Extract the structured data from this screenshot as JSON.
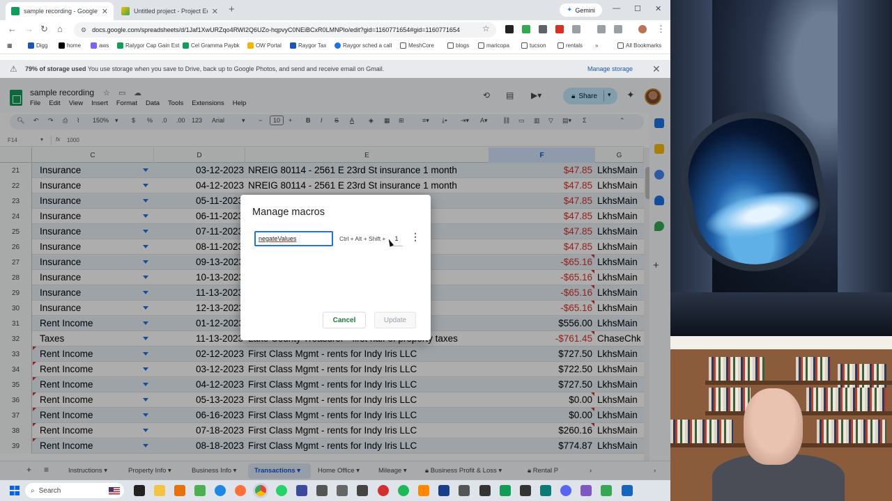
{
  "browser": {
    "tabs": [
      {
        "title": "sample recording - Google She",
        "active": true
      },
      {
        "title": "Untitled project - Project Editor",
        "active": false
      }
    ],
    "gemini_label": "Gemini",
    "url": "docs.google.com/spreadsheets/d/1Jaf1XwURZqo4RWI2Q6UZo-hqpvyC0NEiBCxR0LMNPlo/edit?gid=1160771654#gid=1160771654",
    "bookmarks": [
      "Digg",
      "home",
      "aws",
      "Ralygor Cap Gain Est",
      "Cel Gramma Paybk",
      "OW Portal",
      "Raygor Tax",
      "Raygor sched a call",
      "MeshCore",
      "blogs",
      "maricopa",
      "tucson",
      "rentals"
    ],
    "all_bookmarks": "All Bookmarks"
  },
  "banner": {
    "bold": "79% of storage used",
    "text": "You use storage when you save to Drive, back up to Google Photos, and send and receive email on Gmail.",
    "action": "Manage storage"
  },
  "sheet": {
    "title": "sample recording",
    "menu": [
      "File",
      "Edit",
      "View",
      "Insert",
      "Format",
      "Data",
      "Tools",
      "Extensions",
      "Help"
    ],
    "share": "Share",
    "toolbar": {
      "zoom": "150%",
      "font": "Arial",
      "font_size": "10",
      "currency": "$",
      "percent": "%",
      "dec_dec": ".0",
      "dec_inc": ".00",
      "format": "123"
    },
    "cell_ref": "F14",
    "formula": "1000",
    "columns": [
      "C",
      "D",
      "E",
      "F",
      "G"
    ],
    "rows": [
      {
        "n": "21",
        "c": "Insurance",
        "d": "03-12-2023",
        "e": "NREIG 80114 - 2561 E 23rd St insurance 1 month",
        "f": "$47.85",
        "neg": true,
        "g": "LkhsMain"
      },
      {
        "n": "22",
        "c": "Insurance",
        "d": "04-12-2023",
        "e": "NREIG 80114 - 2561 E 23rd St insurance 1 month",
        "f": "$47.85",
        "neg": true,
        "g": "LkhsMain"
      },
      {
        "n": "23",
        "c": "Insurance",
        "d": "05-11-2023",
        "e": "month",
        "f": "$47.85",
        "neg": true,
        "g": "LkhsMain"
      },
      {
        "n": "24",
        "c": "Insurance",
        "d": "06-11-2023",
        "e": "month",
        "f": "$47.85",
        "neg": true,
        "g": "LkhsMain"
      },
      {
        "n": "25",
        "c": "Insurance",
        "d": "07-11-2023",
        "e": "month",
        "f": "$47.85",
        "neg": true,
        "g": "LkhsMain"
      },
      {
        "n": "26",
        "c": "Insurance",
        "d": "08-11-2023",
        "e": "month",
        "f": "$47.85",
        "neg": true,
        "g": "LkhsMain"
      },
      {
        "n": "27",
        "c": "Insurance",
        "d": "09-13-2023",
        "e": "month",
        "f": "-$65.16",
        "neg": true,
        "g": "LkhsMain"
      },
      {
        "n": "28",
        "c": "Insurance",
        "d": "10-13-2023",
        "e": "month",
        "f": "-$65.16",
        "neg": true,
        "g": "LkhsMain"
      },
      {
        "n": "29",
        "c": "Insurance",
        "d": "11-13-2023",
        "e": "month",
        "f": "-$65.16",
        "neg": true,
        "g": "LkhsMain"
      },
      {
        "n": "30",
        "c": "Insurance",
        "d": "12-13-2023",
        "e": "month",
        "f": "-$65.16",
        "neg": true,
        "g": "LkhsMain"
      },
      {
        "n": "31",
        "c": "Rent Income",
        "d": "01-12-2023",
        "e": "",
        "f": "$556.00",
        "neg": false,
        "g": "LkhsMain"
      },
      {
        "n": "32",
        "c": "Taxes",
        "d": "11-13-2023",
        "e": "Lake County Treasurer - first half of property taxes",
        "f": "-$761.45",
        "neg": true,
        "g": "ChaseChk"
      },
      {
        "n": "33",
        "c": "Rent Income",
        "d": "02-12-2023",
        "e": "First Class Mgmt - rents for Indy Iris LLC",
        "f": "$727.50",
        "neg": false,
        "g": "LkhsMain"
      },
      {
        "n": "34",
        "c": "Rent Income",
        "d": "03-12-2023",
        "e": "First Class Mgmt - rents for Indy Iris LLC",
        "f": "$722.50",
        "neg": false,
        "g": "LkhsMain"
      },
      {
        "n": "35",
        "c": "Rent Income",
        "d": "04-12-2023",
        "e": "First Class Mgmt - rents for Indy Iris LLC",
        "f": "$727.50",
        "neg": false,
        "g": "LkhsMain"
      },
      {
        "n": "36",
        "c": "Rent Income",
        "d": "05-13-2023",
        "e": "First Class Mgmt - rents for Indy Iris LLC",
        "f": "$0.00",
        "neg": false,
        "g": "LkhsMain"
      },
      {
        "n": "37",
        "c": "Rent Income",
        "d": "06-16-2023",
        "e": "First Class Mgmt - rents for Indy Iris LLC",
        "f": "$0.00",
        "neg": false,
        "g": "LkhsMain"
      },
      {
        "n": "38",
        "c": "Rent Income",
        "d": "07-18-2023",
        "e": "First Class Mgmt - rents for Indy Iris LLC",
        "f": "$260.16",
        "neg": false,
        "g": "LkhsMain"
      },
      {
        "n": "39",
        "c": "Rent Income",
        "d": "08-18-2023",
        "e": "First Class Mgmt - rents for Indy Iris LLC",
        "f": "$774.87",
        "neg": false,
        "g": "LkhsMain"
      }
    ],
    "sheet_tabs": [
      "Instructions",
      "Property Info",
      "Business Info",
      "Transactions",
      "Home Office",
      "Mileage",
      "Business Profit & Loss",
      "Rental P"
    ],
    "active_sheet": "Transactions"
  },
  "modal": {
    "title": "Manage macros",
    "macro_name": "negateValues",
    "shortcut_label": "Ctrl + Alt + Shift +",
    "shortcut_key": "1",
    "cancel": "Cancel",
    "update": "Update"
  },
  "taskbar": {
    "search_placeholder": "Search"
  },
  "colors": {
    "accent": "#1a73e8",
    "sheets_green": "#0f9d58",
    "negative": "#d93025",
    "active_tab": "#0b57d0"
  }
}
